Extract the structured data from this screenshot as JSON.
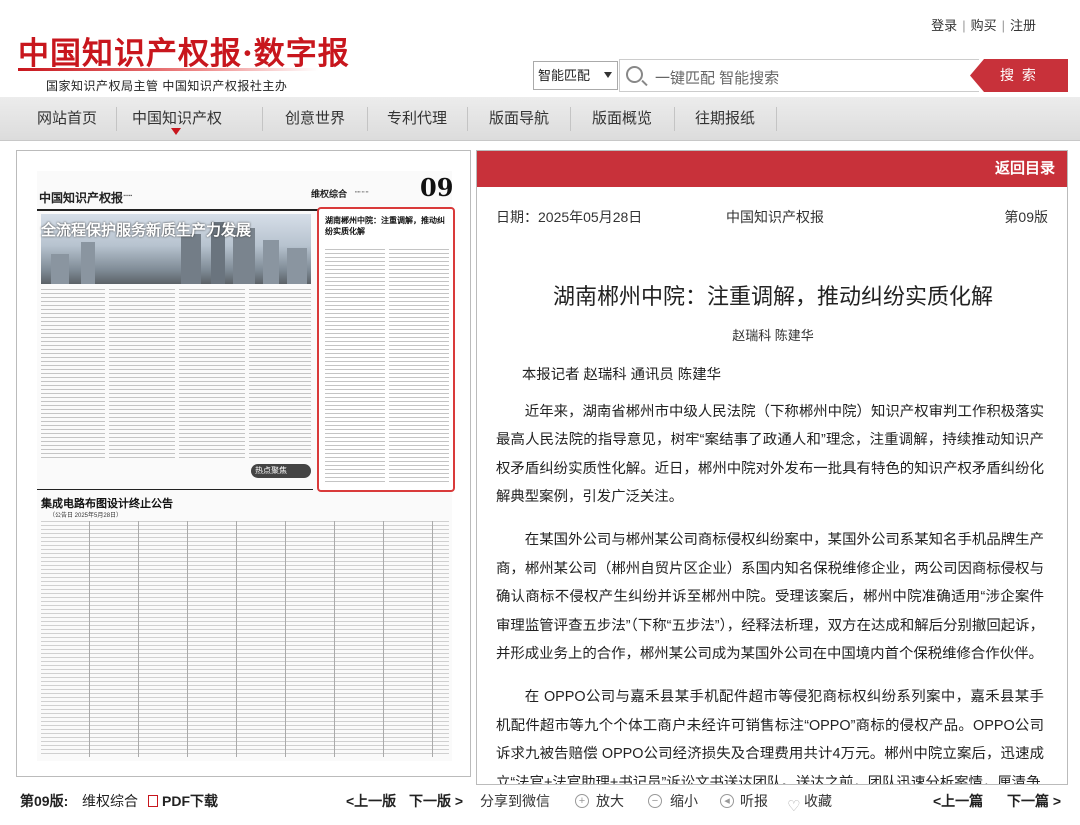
{
  "header": {
    "logo": "中国知识产权报·数字报",
    "subtitle": "国家知识产权局主管  中国知识产权报社主办",
    "top_links": [
      "登录",
      "购买",
      "注册"
    ],
    "search": {
      "mode": "智能匹配",
      "placeholder": "一键匹配 智能搜索",
      "button": "搜 索"
    }
  },
  "nav": {
    "items": [
      "网站首页",
      "中国知识产权报",
      "创意世界",
      "专利代理",
      "版面导航",
      "版面概览",
      "往期报纸"
    ],
    "active": "中国知识产权报"
  },
  "newspaper": {
    "masthead": "中国知识产权报",
    "section": "维权综合",
    "page_number": "09",
    "headline_photo": "全流程保护服务新质生产力发展",
    "boxed_headline": "湖南郴州中院：注重调解，推动纠纷实质化解",
    "hot_label": "热点聚焦",
    "notice_title": "集成电路布图设计终止公告",
    "notice_sub": "（公告日 2025年5月28日）",
    "footer": {
      "issue": "第09版:",
      "section": "维权综合",
      "pdf": "PDF下载",
      "prev": "<上一版",
      "next": "下一版 >"
    }
  },
  "article": {
    "back": "返回目录",
    "date": "日期：2025年05月28日",
    "paper": "中国知识产权报",
    "page": "第09版",
    "title": "湖南郴州中院：注重调解，推动纠纷实质化解",
    "authors": "赵瑞科 陈建华",
    "byline": "本报记者 赵瑞科 通讯员 陈建华",
    "paragraphs": [
      "近年来，湖南省郴州市中级人民法院（下称郴州中院）知识产权审判工作积极落实最高人民法院的指导意见，树牢“案结事了政通人和”理念，注重调解，持续推动知识产权矛盾纠纷实质性化解。近日，郴州中院对外发布一批具有特色的知识产权矛盾纠纷化解典型案例，引发广泛关注。",
      "在某国外公司与郴州某公司商标侵权纠纷案中，某国外公司系某知名手机品牌生产商，郴州某公司（郴州自贸片区企业）系国内知名保税维修企业，两公司因商标侵权与确认商标不侵权产生纠纷并诉至郴州中院。受理该案后，郴州中院准确适用“涉企案件审理监管评查五步法”（下称“五步法”），经释法析理，双方在达成和解后分别撤回起诉，并形成业务上的合作，郴州某公司成为某国外公司在中国境内首个保税维修合作伙伴。",
      "在 OPPO公司与嘉禾县某手机配件超市等侵犯商标权纠纷系列案中，嘉禾县某手机配件超市等九个个体工商户未经许可销售标注“OPPO”商标的侵权产品。OPPO公司诉求九被告赔偿 OPPO公司经济损失及合理费用共计4万元。郴州中院立案后，迅速成立“法官+法官助理+书记员”诉讼文书送达团队。送达之前，团队迅速分析案情，厘清争"
    ],
    "footer": {
      "share": "分享到微信",
      "zoom_in": "放大",
      "zoom_out": "缩小",
      "listen": "听报",
      "favorite": "收藏",
      "prev": "<上一篇",
      "next": "下一篇 >"
    }
  }
}
